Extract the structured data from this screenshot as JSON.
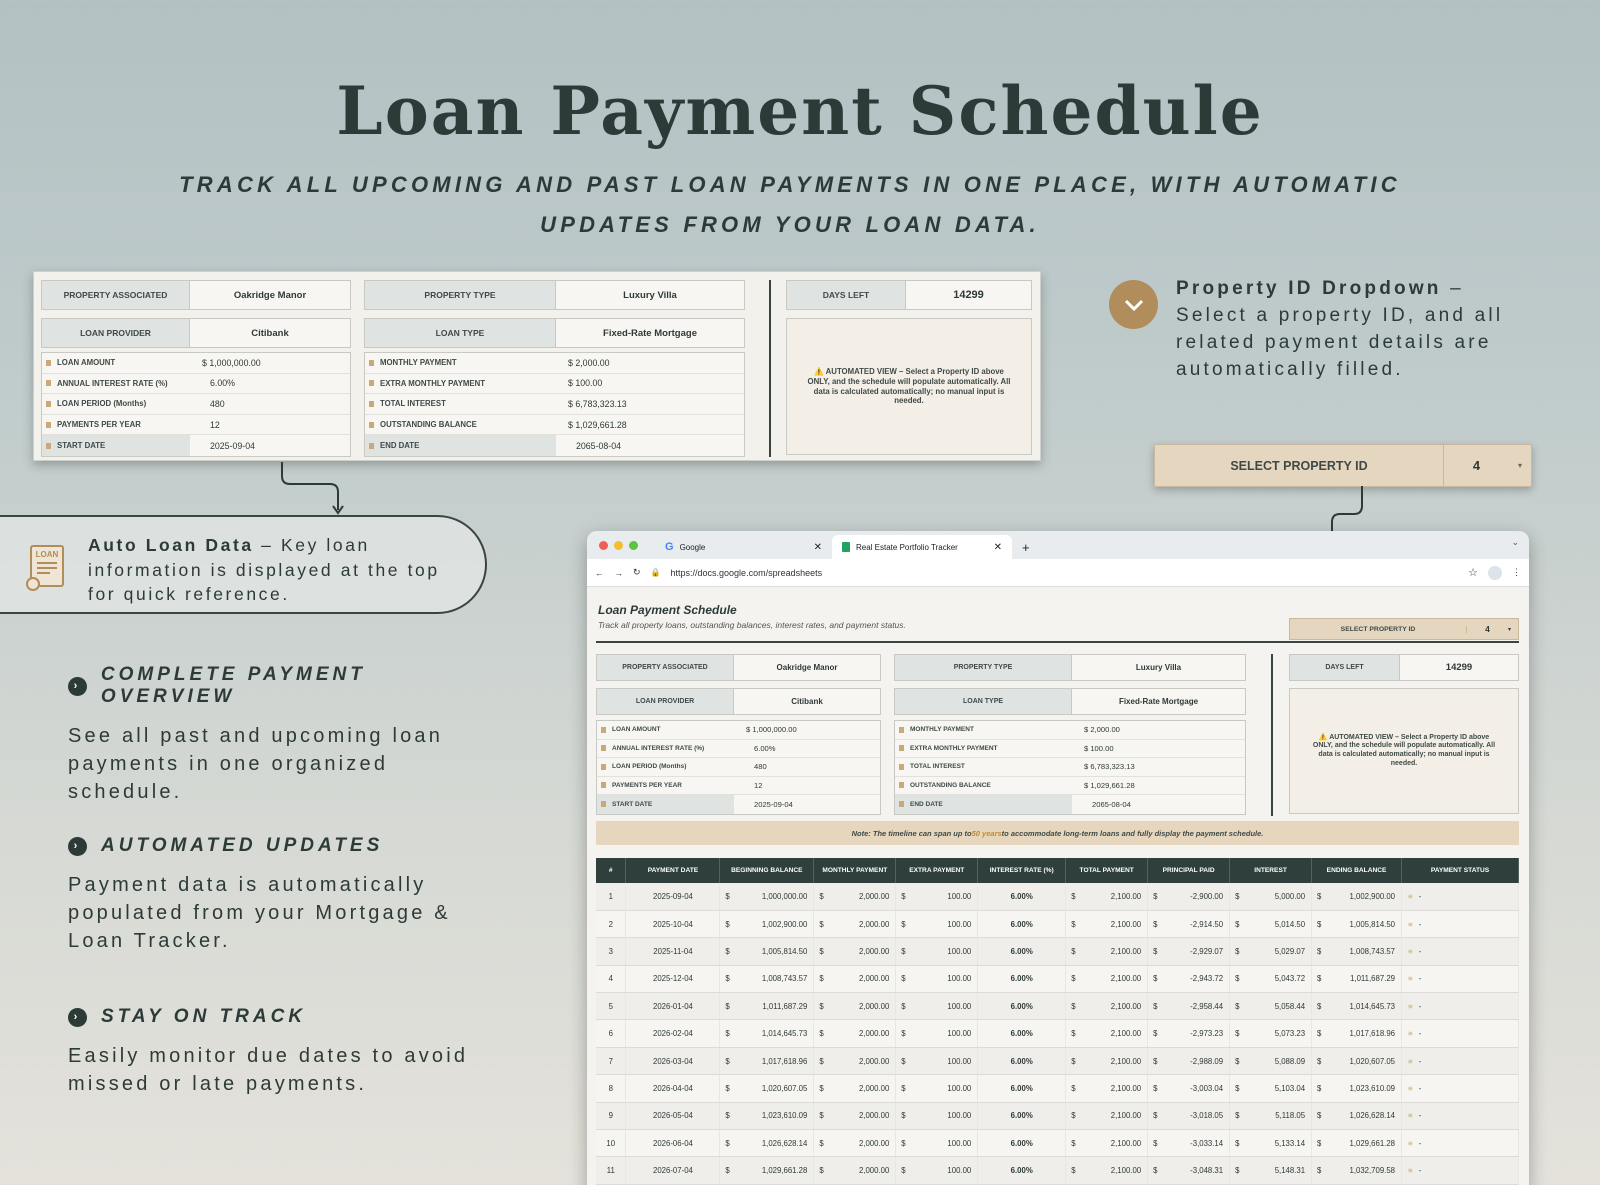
{
  "hero": {
    "title": "Loan Payment Schedule",
    "subtitle": "TRACK ALL UPCOMING AND PAST LOAN PAYMENTS IN ONE PLACE, WITH AUTOMATIC UPDATES FROM YOUR LOAN DATA."
  },
  "summary": {
    "property_associated_label": "PROPERTY ASSOCIATED",
    "property_associated": "Oakridge Manor",
    "property_type_label": "PROPERTY TYPE",
    "property_type": "Luxury Villa",
    "days_left_label": "DAYS LEFT",
    "days_left": "14299",
    "loan_provider_label": "LOAN PROVIDER",
    "loan_provider": "Citibank",
    "loan_type_label": "LOAN TYPE",
    "loan_type": "Fixed-Rate Mortgage",
    "left_rows": [
      {
        "k": "LOAN AMOUNT",
        "cur": "$",
        "v": "1,000,000.00"
      },
      {
        "k": "ANNUAL INTEREST RATE (%)",
        "cur": "",
        "v": "6.00%"
      },
      {
        "k": "LOAN PERIOD (Months)",
        "cur": "",
        "v": "480"
      },
      {
        "k": "PAYMENTS PER YEAR",
        "cur": "",
        "v": "12"
      },
      {
        "k": "START DATE",
        "cur": "",
        "v": "2025-09-04"
      }
    ],
    "right_rows": [
      {
        "k": "MONTHLY PAYMENT",
        "cur": "$",
        "v": "2,000.00"
      },
      {
        "k": "EXTRA MONTHLY PAYMENT",
        "cur": "$",
        "v": "100.00"
      },
      {
        "k": "TOTAL INTEREST",
        "cur": "$",
        "v": "6,783,323.13"
      },
      {
        "k": "OUTSTANDING BALANCE",
        "cur": "$",
        "v": "1,029,661.28"
      },
      {
        "k": "END DATE",
        "cur": "",
        "v": "2065-08-04"
      }
    ],
    "note": "⚠️ AUTOMATED VIEW – Select a Property ID above ONLY, and the schedule will populate automatically. All data is calculated automatically; no manual input is needed."
  },
  "dropdown_callout": {
    "title": "Property ID Dropdown",
    "dash": " –",
    "body": "Select a property ID, and all related payment details are automatically filled."
  },
  "select_property": {
    "label": "SELECT PROPERTY ID",
    "value": "4"
  },
  "auto_loan": {
    "title": "Auto Loan Data",
    "body": " – Key loan information is displayed at the top for quick reference.",
    "icon_text": "LOAN"
  },
  "features": [
    {
      "title": "COMPLETE PAYMENT OVERVIEW",
      "body": "See all past and upcoming loan payments in one organized schedule."
    },
    {
      "title": "AUTOMATED UPDATES",
      "body": "Payment data is automatically populated from your Mortgage & Loan Tracker."
    },
    {
      "title": "STAY ON TRACK",
      "body": "Easily monitor due dates to avoid missed or late payments."
    }
  ],
  "browser": {
    "tab1": "Google",
    "tab2": "Real Estate Portfolio Tracker",
    "url": "https://docs.google.com/spreadsheets",
    "sheet_title": "Loan Payment Schedule",
    "sheet_subtitle": "Track all property loans, outstanding balances, interest rates, and payment status.",
    "timeline_note_pre": "Note: The timeline can span up to ",
    "timeline_note_hl": "50 years",
    "timeline_note_post": " to accommodate long-term loans and fully display the payment schedule.",
    "columns": [
      "#",
      "PAYMENT DATE",
      "BEGINNING BALANCE",
      "MONTHLY PAYMENT",
      "EXTRA PAYMENT",
      "INTEREST RATE (%)",
      "TOTAL PAYMENT",
      "PRINCIPAL PAID",
      "INTEREST",
      "ENDING BALANCE",
      "PAYMENT STATUS"
    ],
    "rows": [
      [
        "1",
        "2025-09-04",
        "1,000,000.00",
        "2,000.00",
        "100.00",
        "6.00%",
        "2,100.00",
        "-2,900.00",
        "5,000.00",
        "1,002,900.00",
        "-"
      ],
      [
        "2",
        "2025-10-04",
        "1,002,900.00",
        "2,000.00",
        "100.00",
        "6.00%",
        "2,100.00",
        "-2,914.50",
        "5,014.50",
        "1,005,814.50",
        "-"
      ],
      [
        "3",
        "2025-11-04",
        "1,005,814.50",
        "2,000.00",
        "100.00",
        "6.00%",
        "2,100.00",
        "-2,929.07",
        "5,029.07",
        "1,008,743.57",
        "-"
      ],
      [
        "4",
        "2025-12-04",
        "1,008,743.57",
        "2,000.00",
        "100.00",
        "6.00%",
        "2,100.00",
        "-2,943.72",
        "5,043.72",
        "1,011,687.29",
        "-"
      ],
      [
        "5",
        "2026-01-04",
        "1,011,687.29",
        "2,000.00",
        "100.00",
        "6.00%",
        "2,100.00",
        "-2,958.44",
        "5,058.44",
        "1,014,645.73",
        "-"
      ],
      [
        "6",
        "2026-02-04",
        "1,014,645.73",
        "2,000.00",
        "100.00",
        "6.00%",
        "2,100.00",
        "-2,973.23",
        "5,073.23",
        "1,017,618.96",
        "-"
      ],
      [
        "7",
        "2026-03-04",
        "1,017,618.96",
        "2,000.00",
        "100.00",
        "6.00%",
        "2,100.00",
        "-2,988.09",
        "5,088.09",
        "1,020,607.05",
        "-"
      ],
      [
        "8",
        "2026-04-04",
        "1,020,607.05",
        "2,000.00",
        "100.00",
        "6.00%",
        "2,100.00",
        "-3,003.04",
        "5,103.04",
        "1,023,610.09",
        "-"
      ],
      [
        "9",
        "2026-05-04",
        "1,023,610.09",
        "2,000.00",
        "100.00",
        "6.00%",
        "2,100.00",
        "-3,018.05",
        "5,118.05",
        "1,026,628.14",
        "-"
      ],
      [
        "10",
        "2026-06-04",
        "1,026,628.14",
        "2,000.00",
        "100.00",
        "6.00%",
        "2,100.00",
        "-3,033.14",
        "5,133.14",
        "1,029,661.28",
        "-"
      ],
      [
        "11",
        "2026-07-04",
        "1,029,661.28",
        "2,000.00",
        "100.00",
        "6.00%",
        "2,100.00",
        "-3,048.31",
        "5,148.31",
        "1,032,709.58",
        "-"
      ]
    ]
  },
  "colors": {
    "dark": "#2d3b38",
    "accent": "#b08d5a",
    "sand": "#e5d6c0"
  }
}
